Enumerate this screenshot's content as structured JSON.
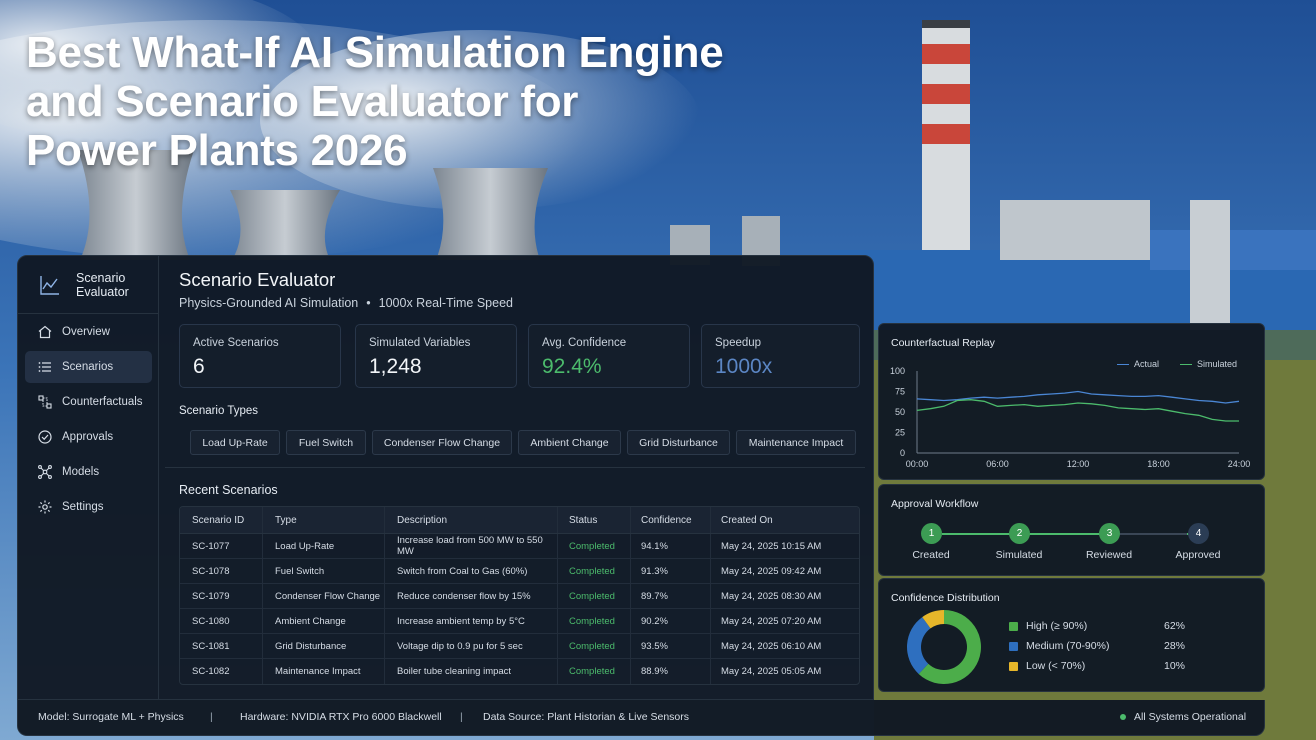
{
  "hero": {
    "line1": "Best What-If AI Simulation Engine",
    "line2": "and Scenario Evaluator for",
    "line3": "Power Plants 2026"
  },
  "sidebar": {
    "brand_line1": "Scenario",
    "brand_line2": "Evaluator",
    "items": [
      {
        "label": "Overview",
        "icon": "home-icon"
      },
      {
        "label": "Scenarios",
        "icon": "list-icon",
        "active": true
      },
      {
        "label": "Counterfactuals",
        "icon": "counterfactual-icon"
      },
      {
        "label": "Approvals",
        "icon": "check-circle-icon"
      },
      {
        "label": "Models",
        "icon": "network-icon"
      },
      {
        "label": "Settings",
        "icon": "gear-icon"
      }
    ]
  },
  "header": {
    "title": "Scenario Evaluator",
    "sub_left": "Physics-Grounded AI Simulation",
    "sub_sep": "•",
    "sub_right": "1000x Real-Time Speed"
  },
  "kpis": [
    {
      "label": "Active Scenarios",
      "value": "6"
    },
    {
      "label": "Simulated Variables",
      "value": "1,248"
    },
    {
      "label": "Avg. Confidence",
      "value": "92.4%"
    },
    {
      "label": "Speedup",
      "value": "1000x"
    }
  ],
  "scenario_types": {
    "title": "Scenario Types",
    "chips": [
      "Load Up-Rate",
      "Fuel Switch",
      "Condenser Flow Change",
      "Ambient Change",
      "Grid Disturbance",
      "Maintenance Impact"
    ]
  },
  "recent": {
    "title": "Recent Scenarios",
    "columns": [
      "Scenario ID",
      "Type",
      "Description",
      "Status",
      "Confidence",
      "Created On"
    ],
    "rows": [
      [
        "SC-1077",
        "Load Up-Rate",
        "Increase load from 500 MW to 550 MW",
        "Completed",
        "94.1%",
        "May 24, 2025 10:15 AM"
      ],
      [
        "SC-1078",
        "Fuel Switch",
        "Switch from Coal to Gas (60%)",
        "Completed",
        "91.3%",
        "May 24, 2025 09:42 AM"
      ],
      [
        "SC-1079",
        "Condenser Flow Change",
        "Reduce condenser flow by 15%",
        "Completed",
        "89.7%",
        "May 24, 2025 08:30 AM"
      ],
      [
        "SC-1080",
        "Ambient Change",
        "Increase ambient temp by 5°C",
        "Completed",
        "90.2%",
        "May 24, 2025 07:20 AM"
      ],
      [
        "SC-1081",
        "Grid Disturbance",
        "Voltage dip to 0.9 pu for 5 sec",
        "Completed",
        "93.5%",
        "May 24, 2025 06:10 AM"
      ],
      [
        "SC-1082",
        "Maintenance Impact",
        "Boiler tube cleaning impact",
        "Completed",
        "88.9%",
        "May 24, 2025 05:05 AM"
      ]
    ]
  },
  "footer": {
    "model": "Model: Surrogate ML + Physics",
    "hardware": "Hardware: NVIDIA RTX Pro 6000 Blackwell",
    "source": "Data Source: Plant Historian & Live Sensors",
    "status": "All Systems Operational",
    "sep": "|"
  },
  "chart_data": {
    "type": "line",
    "title": "Counterfactual Replay",
    "xlabel": "",
    "ylabel": "",
    "ylim": [
      0,
      100
    ],
    "yticks": [
      "100",
      "75",
      "50",
      "25",
      "0"
    ],
    "xticks": [
      "00:00",
      "06:00",
      "12:00",
      "18:00",
      "24:00"
    ],
    "legend_position": "top-right",
    "x": [
      0,
      1,
      2,
      3,
      4,
      5,
      6,
      7,
      8,
      9,
      10,
      11,
      12,
      13,
      14,
      15,
      16,
      17,
      18,
      19,
      20,
      21,
      22,
      23,
      24
    ],
    "series": [
      {
        "name": "Actual",
        "color": "#4a86d4",
        "values": [
          66,
          65,
          64,
          65,
          67,
          68,
          67,
          68,
          69,
          71,
          72,
          73,
          75,
          72,
          71,
          70,
          69,
          69,
          70,
          68,
          66,
          64,
          63,
          61,
          63
        ]
      },
      {
        "name": "Simulated",
        "color": "#4cbb6c",
        "values": [
          52,
          54,
          57,
          64,
          65,
          63,
          57,
          58,
          59,
          57,
          58,
          59,
          61,
          60,
          58,
          55,
          54,
          53,
          54,
          51,
          48,
          46,
          41,
          39,
          39
        ]
      }
    ]
  },
  "approval": {
    "title": "Approval Workflow",
    "steps": [
      {
        "num": "1",
        "label": "Created",
        "done": true
      },
      {
        "num": "2",
        "label": "Simulated",
        "done": true
      },
      {
        "num": "3",
        "label": "Reviewed",
        "done": true
      },
      {
        "num": "4",
        "label": "Approved",
        "done": false
      }
    ]
  },
  "distribution": {
    "title": "Confidence Distribution",
    "slices": [
      {
        "label": "High (≥ 90%)",
        "pct": "62%",
        "value": 62,
        "color": "#4cad4a"
      },
      {
        "label": "Medium (70-90%)",
        "pct": "28%",
        "value": 28,
        "color": "#2e6fbf"
      },
      {
        "label": "Low (< 70%)",
        "pct": "10%",
        "value": 10,
        "color": "#e6b62a"
      }
    ]
  },
  "colors": {
    "accent_green": "#4cbb6c",
    "accent_blue": "#5b86c4",
    "panel_bg": "#111924"
  }
}
